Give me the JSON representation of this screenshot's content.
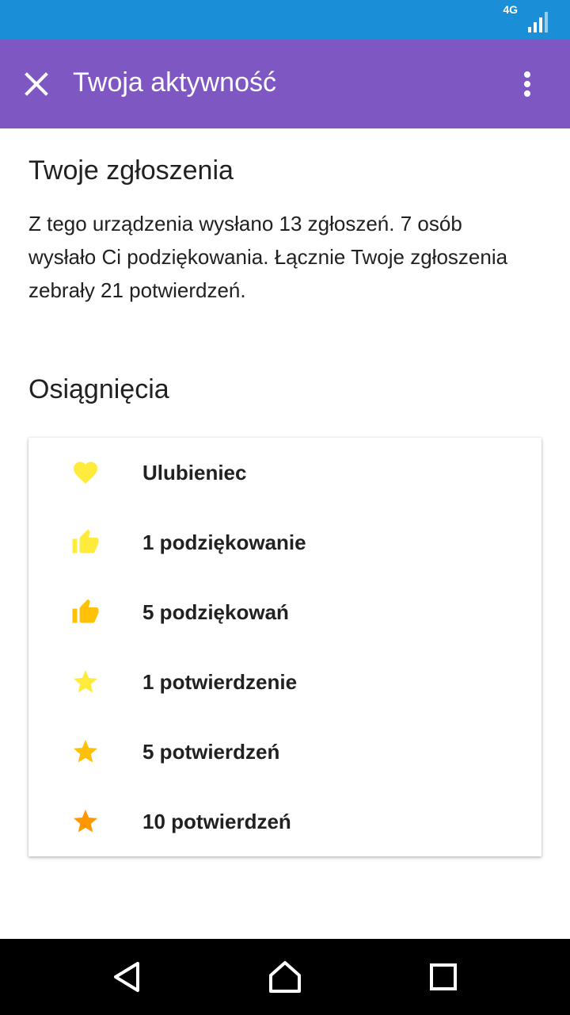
{
  "status_bar": {
    "network": "4G"
  },
  "app_bar": {
    "title": "Twoja aktywność",
    "close_icon": "close-icon",
    "menu_icon": "more-vert-icon",
    "color": "#7e57c2"
  },
  "reports": {
    "title": "Twoje zgłoszenia",
    "summary": "Z tego urządzenia wysłano 13 zgłoszeń. 7 osób wysłało Ci podziękowania. Łącznie Twoje zgłoszenia zebrały 21 potwierdzeń."
  },
  "achievements": {
    "title": "Osiągnięcia",
    "items": [
      {
        "label": "Ulubieniec",
        "icon": "heart-icon",
        "color": "#ffeb3b"
      },
      {
        "label": "1 podziękowanie",
        "icon": "thumb-up-icon",
        "color": "#ffeb3b"
      },
      {
        "label": "5 podziękowań",
        "icon": "thumb-up-icon",
        "color": "#ffc107"
      },
      {
        "label": "1 potwierdzenie",
        "icon": "star-icon",
        "color": "#ffeb3b"
      },
      {
        "label": "5 potwierdzeń",
        "icon": "star-icon",
        "color": "#ffc107"
      },
      {
        "label": "10 potwierdzeń",
        "icon": "star-icon",
        "color": "#ff9800"
      }
    ]
  },
  "nav_bar": {
    "back_icon": "back-icon",
    "home_icon": "home-icon",
    "recents_icon": "recents-icon"
  }
}
